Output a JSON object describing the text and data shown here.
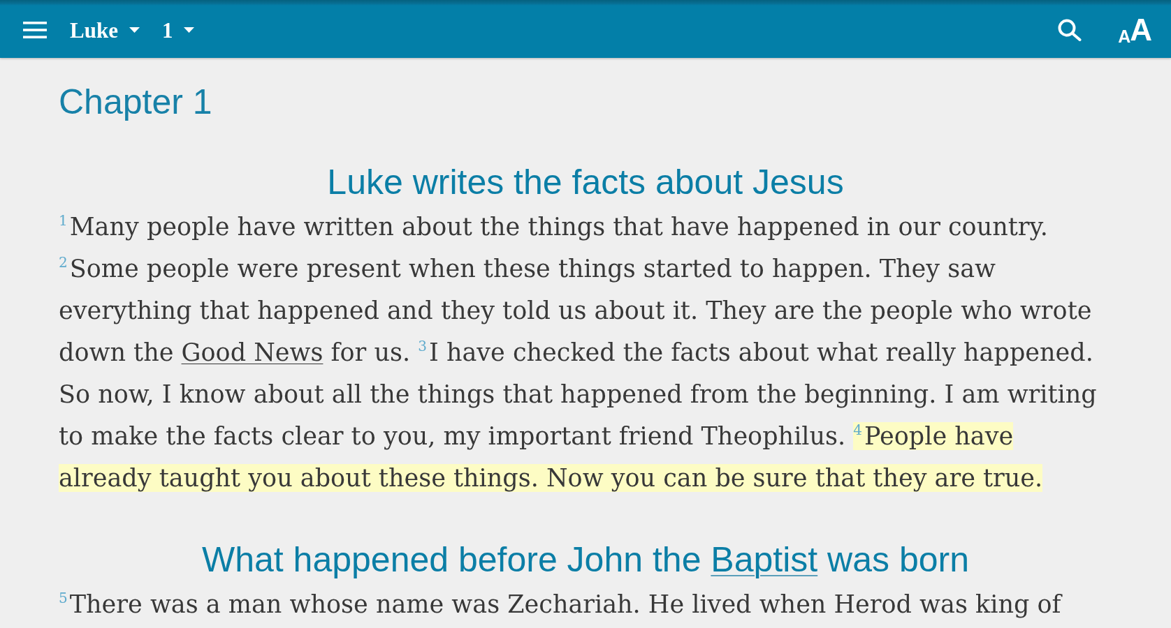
{
  "app_bar": {
    "book": "Luke",
    "chapter": "1",
    "text_size_button": {
      "glyphs": [
        "A",
        "A"
      ]
    }
  },
  "chapter": {
    "title": "Chapter 1",
    "sections": [
      {
        "heading": [
          {
            "kind": "text",
            "text": "Luke writes the facts about Jesus"
          }
        ],
        "verses": [
          {
            "number": "1",
            "highlighted": false,
            "parts": [
              {
                "kind": "text",
                "text": "Many people have written about the things that have happened in our country."
              }
            ]
          },
          {
            "number": "2",
            "highlighted": false,
            "parts": [
              {
                "kind": "text",
                "text": "Some people were present when these things started to happen. They saw everything that happened and they told us about it. They are the people who wrote down the "
              },
              {
                "kind": "link",
                "text": "Good News"
              },
              {
                "kind": "text",
                "text": " for us."
              }
            ]
          },
          {
            "number": "3",
            "highlighted": false,
            "parts": [
              {
                "kind": "text",
                "text": "I have checked the facts about what really happened. So now, I know about all the things that happened from the beginning. I am writing to make the facts clear to you, my important friend Theophilus."
              }
            ]
          },
          {
            "number": "4",
            "highlighted": true,
            "parts": [
              {
                "kind": "text",
                "text": "People have already taught you about these things. Now you can be sure that they are true."
              }
            ]
          }
        ]
      },
      {
        "heading": [
          {
            "kind": "text",
            "text": "What happened before John the "
          },
          {
            "kind": "link",
            "text": "Baptist"
          },
          {
            "kind": "text",
            "text": " was born"
          }
        ],
        "verses": [
          {
            "number": "5",
            "highlighted": false,
            "parts": [
              {
                "kind": "text",
                "text": "There was a man whose name was Zechariah. He lived when Herod was king of"
              }
            ]
          }
        ]
      }
    ]
  }
}
